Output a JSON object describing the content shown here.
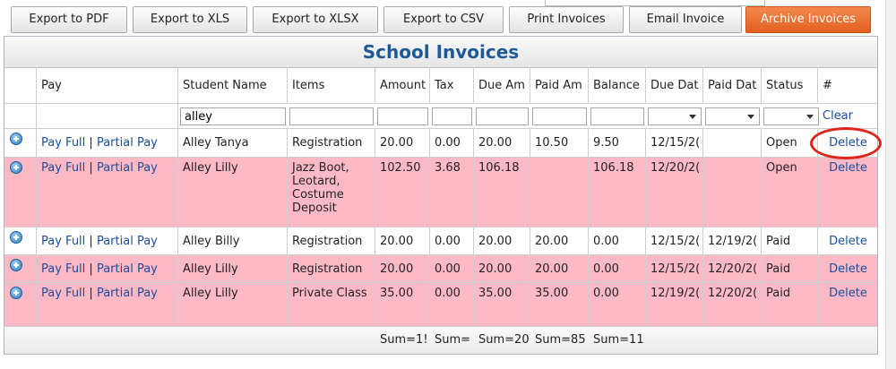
{
  "toolbar": {
    "buttons": [
      {
        "label": "Export to PDF"
      },
      {
        "label": "Export to XLS"
      },
      {
        "label": "Export to XLSX"
      },
      {
        "label": "Export to CSV"
      },
      {
        "label": "Print Invoices"
      },
      {
        "label": "Email Invoice"
      },
      {
        "label": "Archive Invoices"
      }
    ]
  },
  "grid": {
    "title": "School Invoices",
    "columns": {
      "pay": "Pay",
      "student": "Student Name",
      "items": "Items",
      "amount": "Amount",
      "tax": "Tax",
      "due_amount": "Due Am",
      "paid_amount": "Paid Am",
      "balance": "Balance",
      "due_date": "Due Dat",
      "paid_date": "Paid Dat",
      "status": "Status",
      "num": "#"
    },
    "filter": {
      "student_value": "alley",
      "clear": "Clear"
    },
    "pay_full": "Pay Full",
    "partial_pay": "Partial Pay",
    "separator": "|",
    "delete": "Delete",
    "rows": [
      {
        "student": "Alley Tanya",
        "items": "Registration",
        "amount": "20.00",
        "tax": "0.00",
        "due": "20.00",
        "paid": "10.50",
        "balance": "9.50",
        "due_date": "12/15/2(",
        "paid_date": "",
        "status": "Open"
      },
      {
        "student": "Alley Lilly",
        "items": "Jazz Boot, Leotard, Costume Deposit",
        "amount": "102.50",
        "tax": "3.68",
        "due": "106.18",
        "paid": "",
        "balance": "106.18",
        "due_date": "12/20/2(",
        "paid_date": "",
        "status": "Open"
      },
      {
        "student": "Alley Billy",
        "items": "Registration",
        "amount": "20.00",
        "tax": "0.00",
        "due": "20.00",
        "paid": "20.00",
        "balance": "0.00",
        "due_date": "12/15/2(",
        "paid_date": "12/19/2(",
        "status": "Paid"
      },
      {
        "student": "Alley Lilly",
        "items": "Registration",
        "amount": "20.00",
        "tax": "0.00",
        "due": "20.00",
        "paid": "20.00",
        "balance": "0.00",
        "due_date": "12/15/2(",
        "paid_date": "12/20/2(",
        "status": "Paid"
      },
      {
        "student": "Alley Lilly",
        "items": "Private Class",
        "amount": "35.00",
        "tax": "0.00",
        "due": "35.00",
        "paid": "35.00",
        "balance": "0.00",
        "due_date": "12/19/2(",
        "paid_date": "12/20/2(",
        "status": "Paid"
      }
    ],
    "footer": {
      "amount": "Sum=1!",
      "tax": "Sum=",
      "due": "Sum=20",
      "paid": "Sum=85",
      "balance": "Sum=11"
    }
  },
  "colors": {
    "archive_button": "#e8692c",
    "title": "#1e5a96",
    "pink_row": "#fdb9c5",
    "link": "#1a4d9c",
    "highlight_circle": "#e0221b"
  }
}
